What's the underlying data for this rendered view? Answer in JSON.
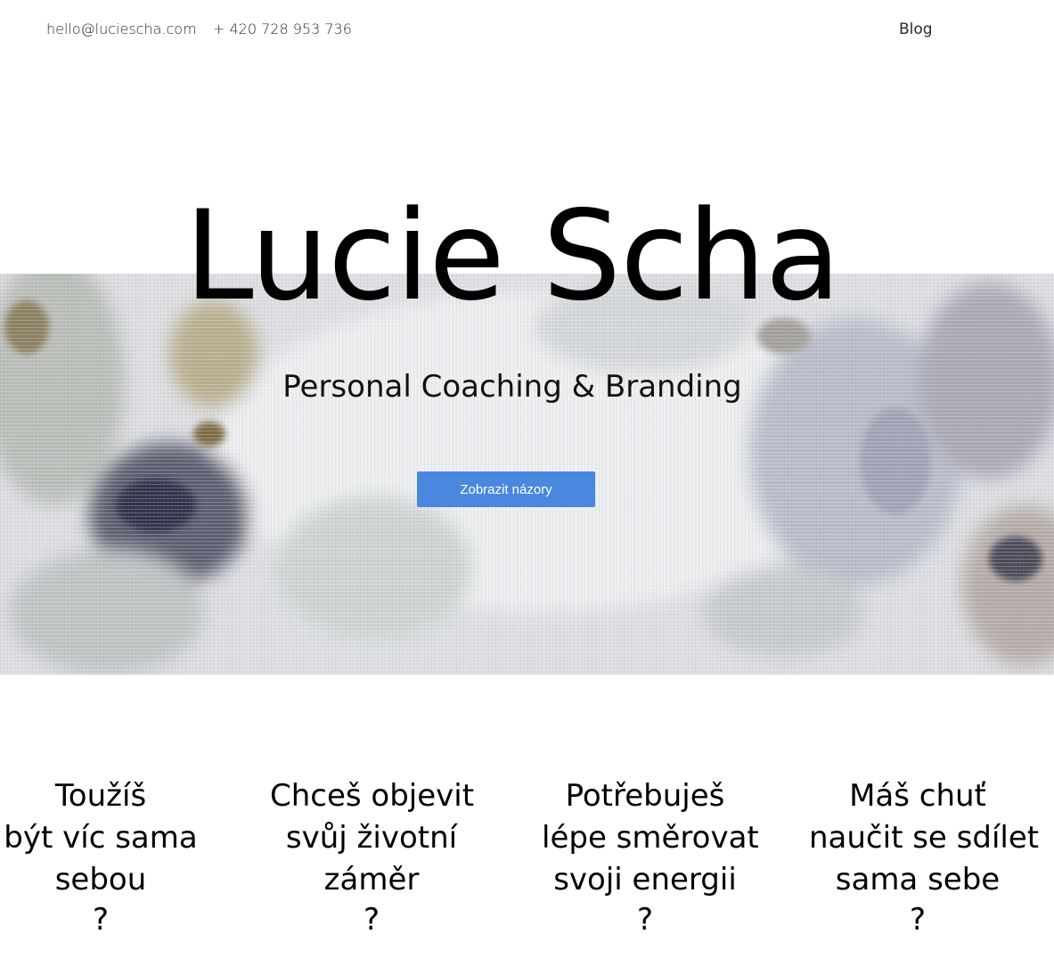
{
  "header": {
    "email": "hello@luciescha.com",
    "phone": "+ 420 728 953 736",
    "nav_blog": "Blog"
  },
  "hero": {
    "title": "Lucie Scha",
    "subtitle": "Personal Coaching & Branding",
    "cta_label": "Zobrazit názory",
    "cta_color": "#4a88e0"
  },
  "questions": [
    {
      "lines": [
        "Toužíš",
        "být víc sama",
        "sebou"
      ],
      "mark": "?"
    },
    {
      "lines": [
        "Chceš objevit",
        "svůj životní",
        "záměr"
      ],
      "mark": "?"
    },
    {
      "lines": [
        "Potřebuješ",
        "lépe směrovat",
        "svoji energii"
      ],
      "mark": "?"
    },
    {
      "lines": [
        "Máš chuť",
        "naučit se sdílet",
        "sama sebe"
      ],
      "mark": "?"
    }
  ]
}
